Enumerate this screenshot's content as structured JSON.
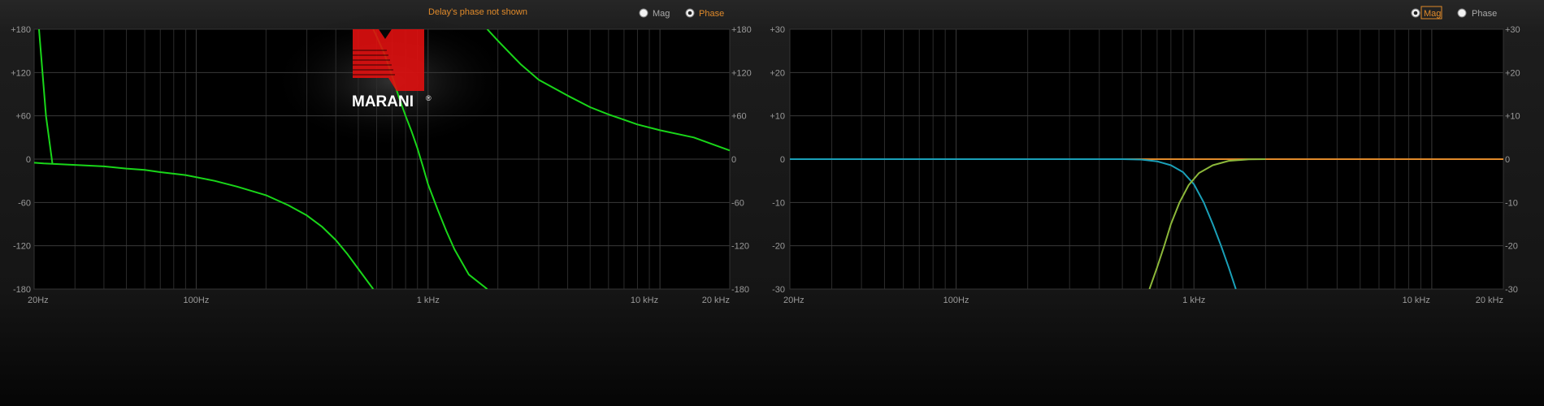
{
  "colors": {
    "grid": "#3a3a3a",
    "grid_minor": "#2c2c2c",
    "tick_text": "#9a9a9a",
    "accent_orange": "#e08a2a",
    "phase_green": "#19d619",
    "mag_yellowgreen": "#8cb83a",
    "mag_teal": "#1aa0b8",
    "logo_red": "#e01010"
  },
  "logo": {
    "text": "MARANI",
    "mark": "®"
  },
  "notice": "Delay's phase not shown",
  "charts": [
    {
      "id": "left",
      "controls": [
        {
          "label": "Mag",
          "selected": false
        },
        {
          "label": "Phase",
          "selected": true
        }
      ],
      "chart_data": {
        "type": "line",
        "x_scale": "log",
        "xlim": [
          20,
          20000
        ],
        "ylim": [
          -180,
          180
        ],
        "x_tick_labels": [
          "20Hz",
          "100Hz",
          "1 kHz",
          "10 kHz",
          "20 kHz"
        ],
        "x_tick_values": [
          20,
          100,
          1000,
          10000,
          20000
        ],
        "y_tick_labels": [
          "+180",
          "+120",
          "+60",
          "0",
          "-60",
          "-120",
          "-180"
        ],
        "y_tick_values": [
          180,
          120,
          60,
          0,
          -60,
          -120,
          -180
        ],
        "grid": true,
        "series": [
          {
            "color_key": "phase_green",
            "points": [
              [
                20,
                -5
              ],
              [
                22,
                -6
              ],
              [
                30,
                -8
              ],
              [
                40,
                -10
              ],
              [
                50,
                -13
              ],
              [
                60,
                -15
              ],
              [
                70,
                -18
              ],
              [
                90,
                -22
              ],
              [
                120,
                -30
              ],
              [
                150,
                -38
              ],
              [
                200,
                -50
              ],
              [
                250,
                -64
              ],
              [
                300,
                -78
              ],
              [
                350,
                -94
              ],
              [
                400,
                -112
              ],
              [
                450,
                -132
              ],
              [
                500,
                -152
              ],
              [
                550,
                -170
              ],
              [
                580,
                -180
              ],
              null,
              [
                580,
                180
              ],
              [
                600,
                170
              ],
              [
                650,
                145
              ],
              [
                700,
                115
              ],
              [
                750,
                85
              ],
              [
                800,
                60
              ],
              [
                850,
                38
              ],
              [
                900,
                15
              ],
              [
                950,
                -10
              ],
              [
                1000,
                -35
              ],
              [
                1100,
                -70
              ],
              [
                1200,
                -100
              ],
              [
                1300,
                -125
              ],
              [
                1500,
                -160
              ],
              [
                1800,
                -180
              ],
              null,
              [
                1800,
                180
              ],
              [
                2000,
                164
              ],
              [
                2500,
                132
              ],
              [
                3000,
                110
              ],
              [
                4000,
                88
              ],
              [
                5000,
                72
              ],
              [
                6000,
                62
              ],
              [
                8000,
                48
              ],
              [
                10000,
                40
              ],
              [
                14000,
                30
              ],
              [
                20000,
                12
              ]
            ]
          },
          {
            "color_key": "phase_green",
            "points": [
              [
                21,
                180
              ],
              [
                22.5,
                60
              ],
              [
                24,
                -7
              ]
            ]
          }
        ]
      }
    },
    {
      "id": "right",
      "controls": [
        {
          "label": "Mag",
          "selected": true
        },
        {
          "label": "Phase",
          "selected": false
        }
      ],
      "chart_data": {
        "type": "line",
        "x_scale": "log",
        "xlim": [
          20,
          20000
        ],
        "ylim": [
          -30,
          30
        ],
        "x_tick_labels": [
          "20Hz",
          "100Hz",
          "1 kHz",
          "10 kHz",
          "20 kHz"
        ],
        "x_tick_values": [
          20,
          100,
          1000,
          10000,
          20000
        ],
        "y_tick_labels": [
          "+30",
          "+20",
          "+10",
          "0",
          "-10",
          "-20",
          "-30"
        ],
        "y_tick_values": [
          30,
          20,
          10,
          0,
          -10,
          -20,
          -30
        ],
        "grid": true,
        "series": [
          {
            "color_key": "accent_orange",
            "points": [
              [
                20,
                0
              ],
              [
                20000,
                0
              ]
            ]
          },
          {
            "color_key": "mag_teal",
            "points": [
              [
                20,
                0
              ],
              [
                500,
                0
              ],
              [
                600,
                -0.1
              ],
              [
                700,
                -0.5
              ],
              [
                800,
                -1.4
              ],
              [
                900,
                -3
              ],
              [
                1000,
                -5.8
              ],
              [
                1100,
                -10
              ],
              [
                1200,
                -15
              ],
              [
                1300,
                -20
              ],
              [
                1400,
                -25
              ],
              [
                1500,
                -30
              ]
            ]
          },
          {
            "color_key": "mag_yellowgreen",
            "points": [
              [
                650,
                -30
              ],
              [
                700,
                -25
              ],
              [
                750,
                -20
              ],
              [
                800,
                -15
              ],
              [
                870,
                -10
              ],
              [
                950,
                -6
              ],
              [
                1050,
                -3.2
              ],
              [
                1200,
                -1.4
              ],
              [
                1400,
                -0.4
              ],
              [
                1700,
                -0.05
              ],
              [
                2000,
                0
              ]
            ]
          }
        ]
      }
    }
  ]
}
